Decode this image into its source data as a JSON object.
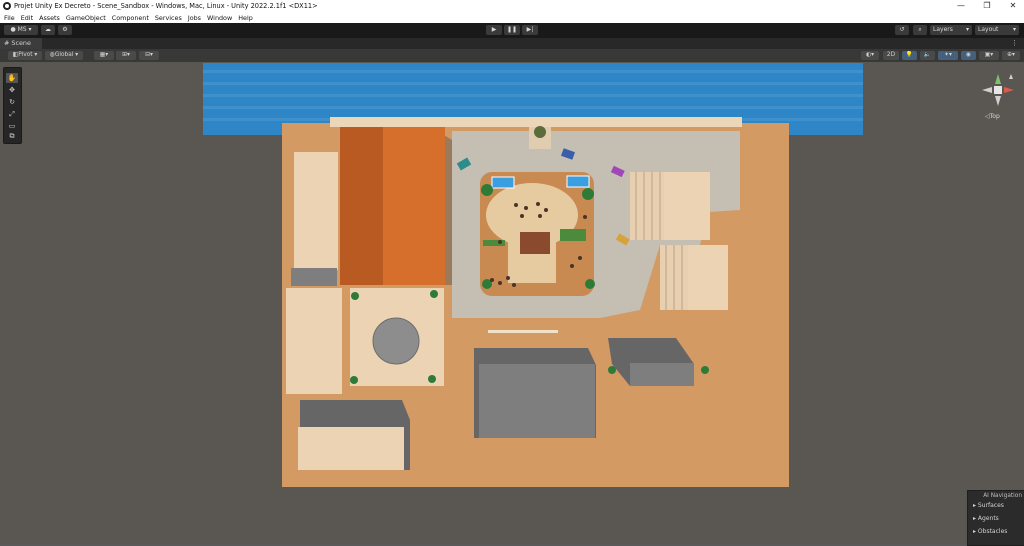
{
  "window": {
    "title": "Projet Unity Ex Decreto - Scene_Sandbox - Windows, Mac, Linux - Unity 2022.2.1f1 <DX11>",
    "minimize_glyph": "—",
    "maximize_glyph": "❐",
    "close_glyph": "✕"
  },
  "menu": [
    "File",
    "Edit",
    "Assets",
    "GameObject",
    "Component",
    "Services",
    "Jobs",
    "Window",
    "Help"
  ],
  "toolbar": {
    "account_label": "MS ▾",
    "layers_label": "Layers",
    "layout_label": "Layout"
  },
  "scene_tab": {
    "label": "Scene"
  },
  "scene_toolbar": {
    "pivot_label": "Pivot ▾",
    "global_label": "Global ▾",
    "mode_2d_label": "2D"
  },
  "gizmo": {
    "view_label": "Top"
  },
  "ai_navigation": {
    "title": "AI Navigation",
    "items": [
      "Surfaces",
      "Agents",
      "Obstacles"
    ]
  },
  "colors": {
    "water": "#2f86c6",
    "ground": "#d39a64",
    "roof_orange": "#d66e2c",
    "building_beige": "#ecd3b4",
    "gravel": "#c5beb3",
    "plaza": "#e7cba0",
    "concrete": "#7e7e7e",
    "selection_blue": "#46607c"
  }
}
